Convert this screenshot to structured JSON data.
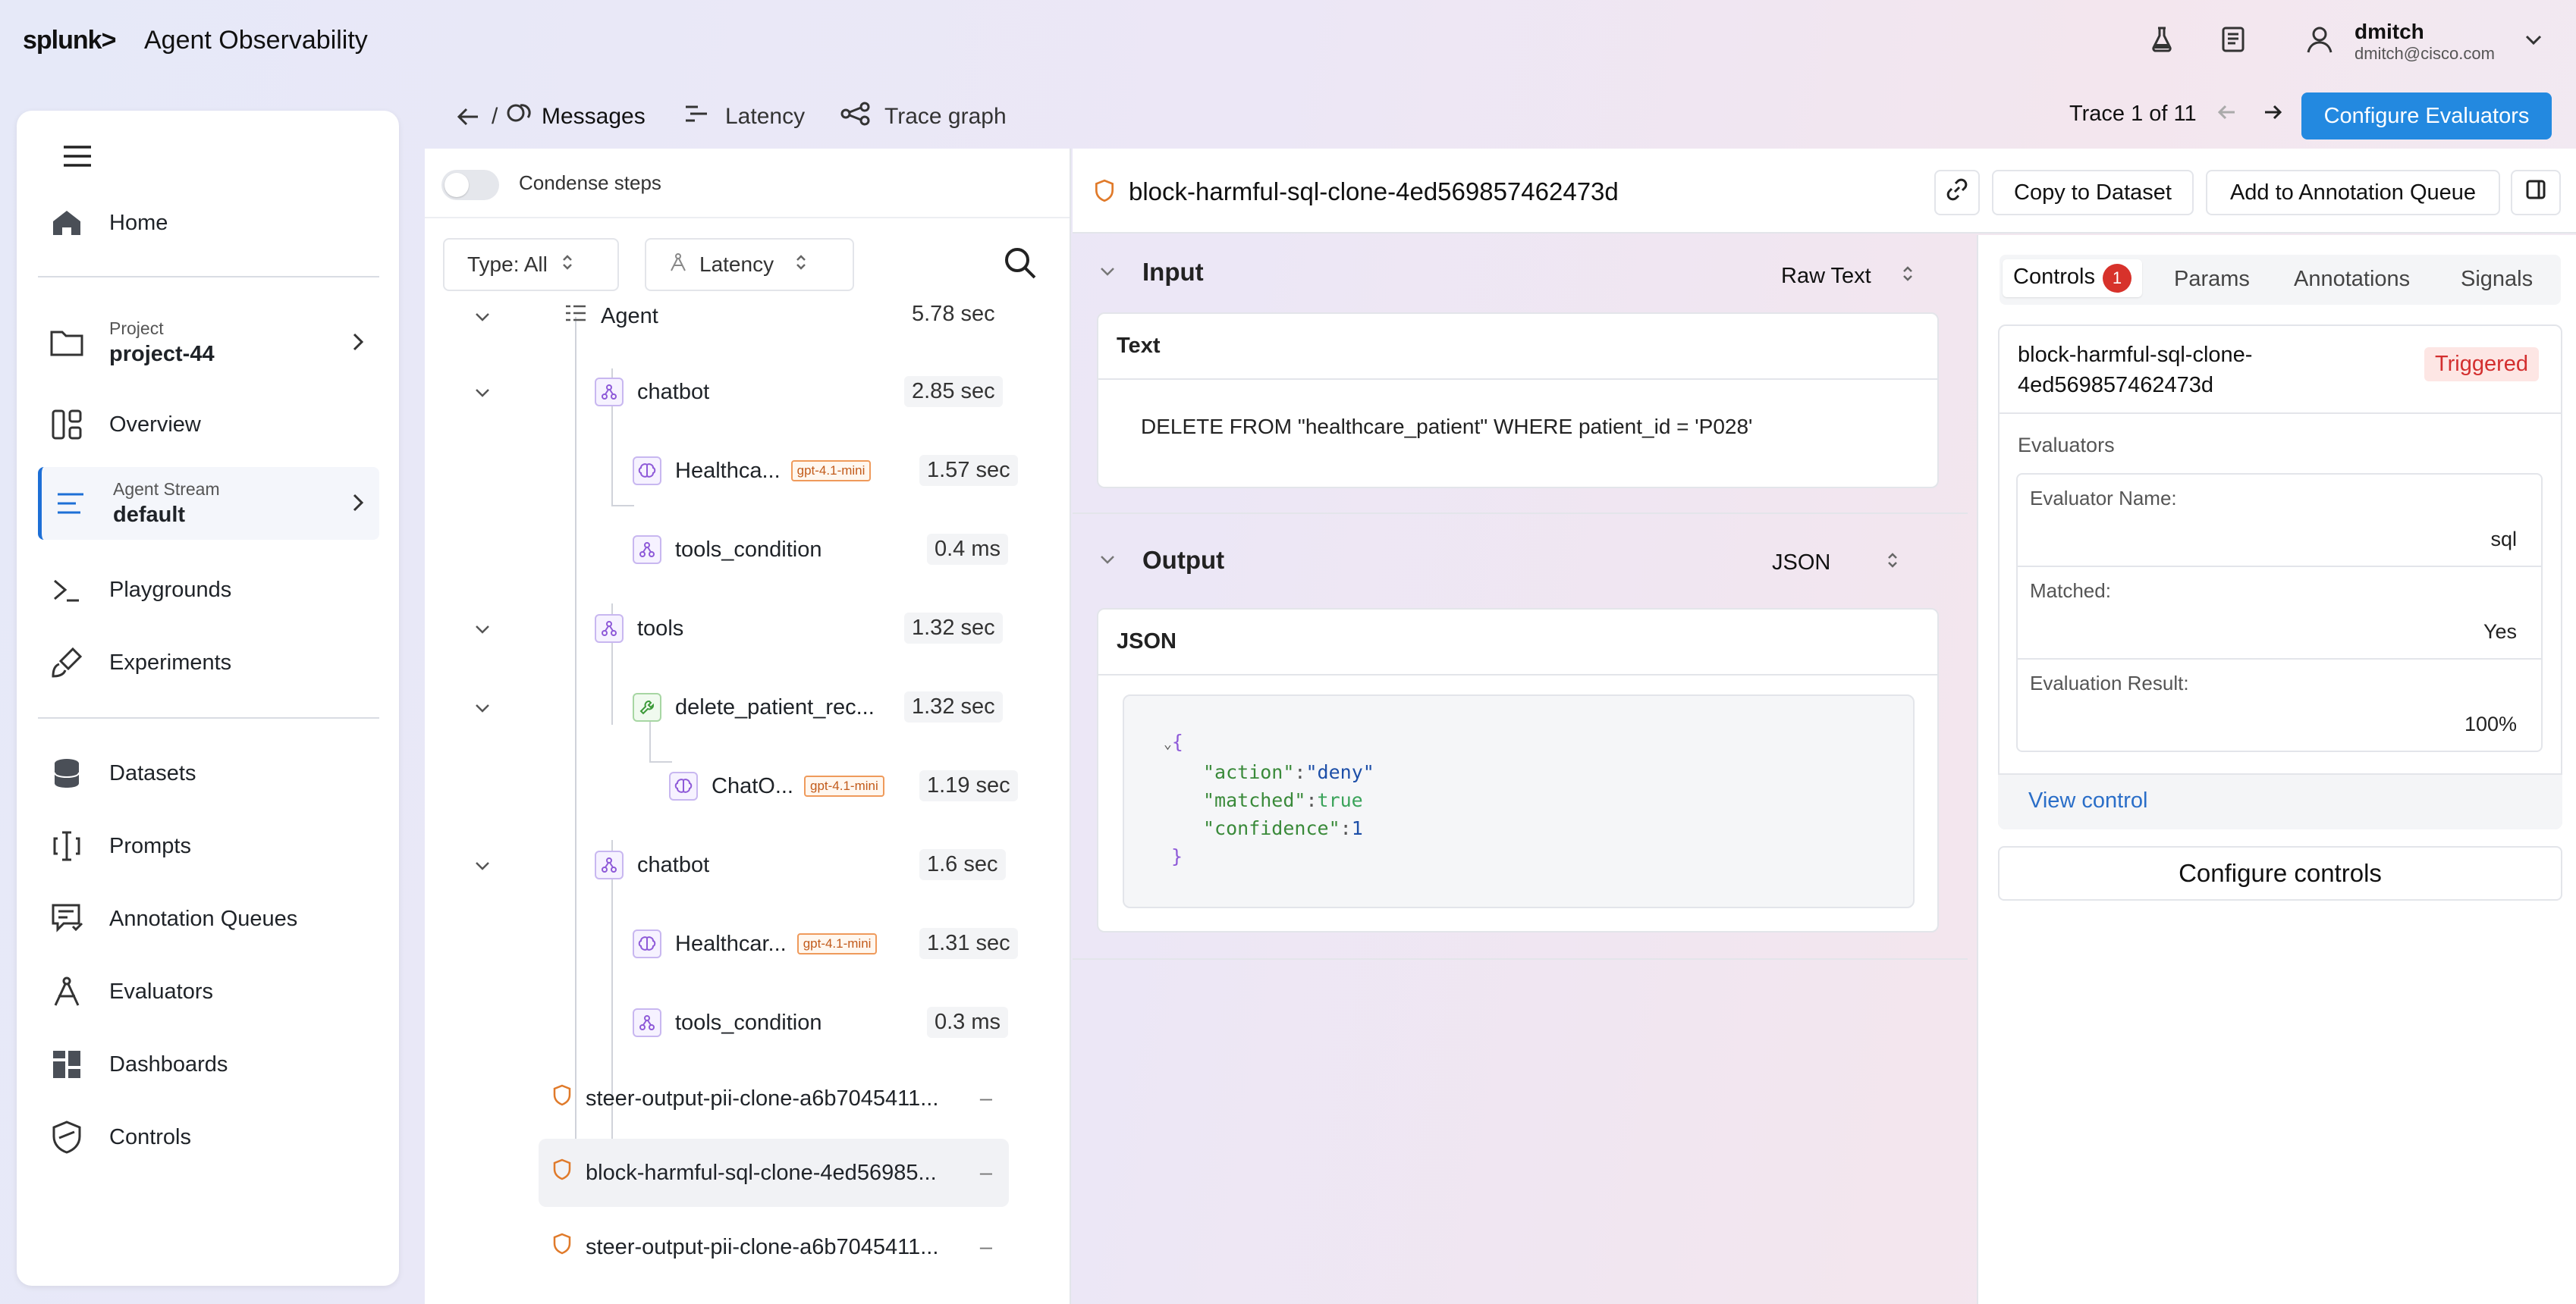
{
  "header": {
    "logo": "splunk>",
    "app_title": "Agent Observability",
    "user_name": "dmitch",
    "user_email": "dmitch@cisco.com"
  },
  "nav": {
    "home": "Home",
    "project_label": "Project",
    "project_value": "project-44",
    "overview": "Overview",
    "agent_stream_label": "Agent Stream",
    "agent_stream_value": "default",
    "playgrounds": "Playgrounds",
    "experiments": "Experiments",
    "datasets": "Datasets",
    "prompts": "Prompts",
    "annotation_queues": "Annotation Queues",
    "evaluators": "Evaluators",
    "dashboards": "Dashboards",
    "controls": "Controls"
  },
  "tabs": {
    "messages": "Messages",
    "latency": "Latency",
    "trace_graph": "Trace graph",
    "breadcrumb_sep": "/"
  },
  "trace": {
    "label": "Trace 1 of 11",
    "configure_evaluators": "Configure Evaluators"
  },
  "tree": {
    "condense_label": "Condense steps",
    "type_filter": "Type: All",
    "sort_filter": "Latency",
    "rows": [
      {
        "label": "Agent",
        "time": "5.78 sec"
      },
      {
        "label": "chatbot",
        "time": "2.85 sec"
      },
      {
        "label": "Healthca...",
        "badge": "gpt-4.1-mini",
        "time": "1.57 sec"
      },
      {
        "label": "tools_condition",
        "time": "0.4 ms"
      },
      {
        "label": "tools",
        "time": "1.32 sec"
      },
      {
        "label": "delete_patient_rec...",
        "time": "1.32 sec"
      },
      {
        "label": "ChatO...",
        "badge": "gpt-4.1-mini",
        "time": "1.19 sec"
      },
      {
        "label": "chatbot",
        "time": "1.6 sec"
      },
      {
        "label": "Healthcar...",
        "badge": "gpt-4.1-mini",
        "time": "1.31 sec"
      },
      {
        "label": "tools_condition",
        "time": "0.3 ms"
      }
    ],
    "controls": [
      {
        "label": "steer-output-pii-clone-a6b7045411...",
        "dash": "–"
      },
      {
        "label": "block-harmful-sql-clone-4ed56985...",
        "dash": "–"
      },
      {
        "label": "steer-output-pii-clone-a6b7045411...",
        "dash": "–"
      }
    ]
  },
  "detail": {
    "title": "block-harmful-sql-clone-4ed569857462473d",
    "copy_to_dataset": "Copy to Dataset",
    "add_to_queue": "Add to Annotation Queue",
    "input_title": "Input",
    "input_format": "Raw Text",
    "text_label": "Text",
    "input_text": "DELETE FROM \"healthcare_patient\" WHERE patient_id = 'P028'",
    "output_title": "Output",
    "output_format": "JSON",
    "json_label": "JSON",
    "json_open": "{",
    "json_close": "}",
    "json_k1": "\"action\"",
    "json_v1": "\"deny\"",
    "json_k2": "\"matched\"",
    "json_v2": "true",
    "json_k3": "\"confidence\"",
    "json_v3": "1"
  },
  "right": {
    "tab_controls": "Controls",
    "controls_count": "1",
    "tab_params": "Params",
    "tab_annotations": "Annotations",
    "tab_signals": "Signals",
    "control_name_line1": "block-harmful-sql-clone-",
    "control_name_line2": "4ed569857462473d",
    "status": "Triggered",
    "evaluators_label": "Evaluators",
    "eval_name_key": "Evaluator Name:",
    "eval_name_val": "sql",
    "matched_key": "Matched:",
    "matched_val": "Yes",
    "result_key": "Evaluation Result:",
    "result_val": "100%",
    "view_control": "View control",
    "configure_controls": "Configure controls"
  },
  "colors": {
    "primary": "#2389e0",
    "triggered": "#d32f2f",
    "badge_orange": "#ef9a5b"
  }
}
